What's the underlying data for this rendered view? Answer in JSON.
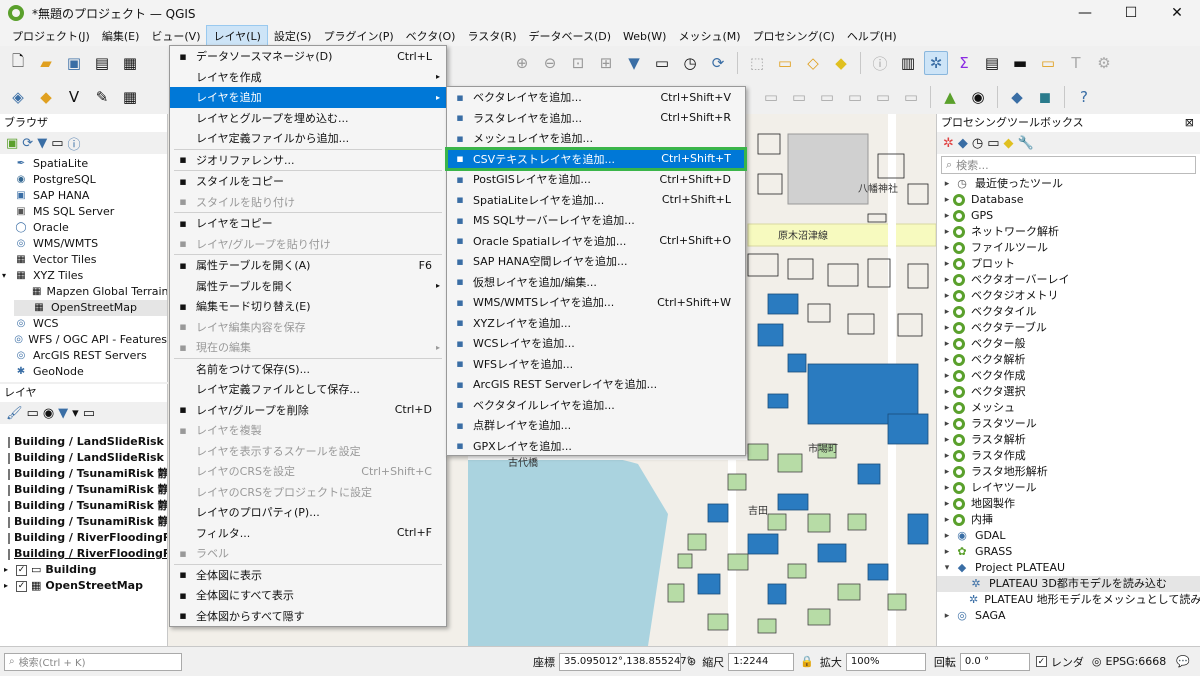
{
  "window": {
    "title": "*無題のプロジェクト — QGIS",
    "minimize": "—",
    "maximize": "☐",
    "close": "✕"
  },
  "menubar": [
    "プロジェクト(J)",
    "編集(E)",
    "ビュー(V)",
    "レイヤ(L)",
    "設定(S)",
    "プラグイン(P)",
    "ベクタ(O)",
    "ラスタ(R)",
    "データベース(D)",
    "Web(W)",
    "メッシュ(M)",
    "プロセシング(C)",
    "ヘルプ(H)"
  ],
  "browser": {
    "title": "ブラウザ",
    "items": [
      {
        "label": "SpatiaLite",
        "icon": "feather-icon"
      },
      {
        "label": "PostgreSQL",
        "icon": "elephant-icon"
      },
      {
        "label": "SAP HANA",
        "icon": "database-icon"
      },
      {
        "label": "MS SQL Server",
        "icon": "database-icon"
      },
      {
        "label": "Oracle",
        "icon": "database-icon"
      },
      {
        "label": "WMS/WMTS",
        "icon": "globe-icon"
      },
      {
        "label": "Vector Tiles",
        "icon": "tiles-icon"
      },
      {
        "label": "XYZ Tiles",
        "icon": "tiles-icon"
      },
      {
        "label": "Mapzen Global Terrain",
        "icon": "tiles-icon"
      },
      {
        "label": "OpenStreetMap",
        "icon": "tiles-icon"
      },
      {
        "label": "WCS",
        "icon": "globe-icon"
      },
      {
        "label": "WFS / OGC API - Features",
        "icon": "globe-icon"
      },
      {
        "label": "ArcGIS REST Servers",
        "icon": "globe-icon"
      },
      {
        "label": "GeoNode",
        "icon": "node-icon"
      }
    ]
  },
  "layers": {
    "title": "レイヤ",
    "items": [
      "Building / LandSlideRisk 急",
      "Building / LandSlideRisk 土",
      "Building / TsunamiRisk 静岡",
      "Building / TsunamiRisk 静岡",
      "Building / TsunamiRisk 静岡",
      "Building / TsunamiRisk 静岡",
      "Building / RiverFloodingRis",
      "Building / RiverFloodingRis"
    ],
    "group": "Building",
    "base": "OpenStreetMap"
  },
  "layer_menu": {
    "items": [
      {
        "label": "データソースマネージャ(D)",
        "shortcut": "Ctrl+L",
        "state": "normal",
        "icon": "datasource-icon"
      },
      {
        "label": "レイヤを作成",
        "shortcut": "",
        "state": "normal",
        "sub": true,
        "icon": ""
      },
      {
        "label": "レイヤを追加",
        "shortcut": "",
        "state": "highlight",
        "sub": true,
        "icon": ""
      },
      {
        "label": "レイヤとグループを埋め込む...",
        "shortcut": "",
        "state": "normal",
        "icon": ""
      },
      {
        "label": "レイヤ定義ファイルから追加...",
        "shortcut": "",
        "state": "normal",
        "icon": ""
      },
      {
        "label": "ジオリファレンサ...",
        "shortcut": "",
        "state": "normal",
        "icon": "georef-icon",
        "sepBefore": true
      },
      {
        "label": "スタイルをコピー",
        "shortcut": "",
        "state": "normal",
        "icon": "copy-style-icon",
        "sepBefore": true
      },
      {
        "label": "スタイルを貼り付け",
        "shortcut": "",
        "state": "disabled",
        "icon": "paste-style-icon"
      },
      {
        "label": "レイヤをコピー",
        "shortcut": "",
        "state": "normal",
        "icon": "copy-layer-icon",
        "sepBefore": true
      },
      {
        "label": "レイヤ/グループを貼り付け",
        "shortcut": "",
        "state": "disabled",
        "icon": "paste-layer-icon"
      },
      {
        "label": "属性テーブルを開く(A)",
        "shortcut": "F6",
        "state": "normal",
        "icon": "table-icon",
        "sepBefore": true
      },
      {
        "label": "属性テーブルを開く",
        "shortcut": "",
        "state": "normal",
        "sub": true,
        "icon": ""
      },
      {
        "label": "編集モード切り替え(E)",
        "shortcut": "",
        "state": "normal",
        "icon": "pencil-icon"
      },
      {
        "label": "レイヤ編集内容を保存",
        "shortcut": "",
        "state": "disabled",
        "icon": "save-edits-icon"
      },
      {
        "label": "現在の編集",
        "shortcut": "",
        "state": "disabled",
        "sub": true,
        "icon": "edit-icon"
      },
      {
        "label": "名前をつけて保存(S)...",
        "shortcut": "",
        "state": "normal",
        "icon": "",
        "sepBefore": true
      },
      {
        "label": "レイヤ定義ファイルとして保存...",
        "shortcut": "",
        "state": "normal",
        "icon": ""
      },
      {
        "label": "レイヤ/グループを削除",
        "shortcut": "Ctrl+D",
        "state": "normal",
        "icon": "remove-icon"
      },
      {
        "label": "レイヤを複製",
        "shortcut": "",
        "state": "disabled",
        "icon": "duplicate-icon"
      },
      {
        "label": "レイヤを表示するスケールを設定",
        "shortcut": "",
        "state": "disabled",
        "icon": ""
      },
      {
        "label": "レイヤのCRSを設定",
        "shortcut": "Ctrl+Shift+C",
        "state": "disabled",
        "icon": ""
      },
      {
        "label": "レイヤのCRSをプロジェクトに設定",
        "shortcut": "",
        "state": "disabled",
        "icon": ""
      },
      {
        "label": "レイヤのプロパティ(P)...",
        "shortcut": "",
        "state": "normal",
        "icon": ""
      },
      {
        "label": "フィルタ...",
        "shortcut": "Ctrl+F",
        "state": "normal",
        "icon": ""
      },
      {
        "label": "ラベル",
        "shortcut": "",
        "state": "disabled",
        "icon": "label-icon"
      },
      {
        "label": "全体図に表示",
        "shortcut": "",
        "state": "normal",
        "icon": "overview-icon",
        "sepBefore": true
      },
      {
        "label": "全体図にすべて表示",
        "shortcut": "",
        "state": "normal",
        "icon": "overview-icon"
      },
      {
        "label": "全体図からすべて隠す",
        "shortcut": "",
        "state": "normal",
        "icon": "overview-icon"
      }
    ]
  },
  "add_layer_menu": {
    "items": [
      {
        "label": "ベクタレイヤを追加...",
        "shortcut": "Ctrl+Shift+V",
        "icon": "vector-icon"
      },
      {
        "label": "ラスタレイヤを追加...",
        "shortcut": "Ctrl+Shift+R",
        "icon": "raster-icon"
      },
      {
        "label": "メッシュレイヤを追加...",
        "shortcut": "",
        "icon": "mesh-icon"
      },
      {
        "label": "CSVテキストレイヤを追加...",
        "shortcut": "Ctrl+Shift+T",
        "icon": "csv-icon",
        "highlight": true
      },
      {
        "label": "PostGISレイヤを追加...",
        "shortcut": "Ctrl+Shift+D",
        "icon": "postgis-icon"
      },
      {
        "label": "SpatiaLiteレイヤを追加...",
        "shortcut": "Ctrl+Shift+L",
        "icon": "spatialite-icon"
      },
      {
        "label": "MS SQLサーバーレイヤを追加...",
        "shortcut": "",
        "icon": "mssql-icon"
      },
      {
        "label": "Oracle Spatialレイヤを追加...",
        "shortcut": "Ctrl+Shift+O",
        "icon": "oracle-icon"
      },
      {
        "label": "SAP HANA空間レイヤを追加...",
        "shortcut": "",
        "icon": "hana-icon"
      },
      {
        "label": "仮想レイヤを追加/編集...",
        "shortcut": "",
        "icon": "virtual-icon"
      },
      {
        "label": "WMS/WMTSレイヤを追加...",
        "shortcut": "Ctrl+Shift+W",
        "icon": "wms-icon"
      },
      {
        "label": "XYZレイヤを追加...",
        "shortcut": "",
        "icon": "xyz-icon"
      },
      {
        "label": "WCSレイヤを追加...",
        "shortcut": "",
        "icon": "wcs-icon"
      },
      {
        "label": "WFSレイヤを追加...",
        "shortcut": "",
        "icon": "wfs-icon"
      },
      {
        "label": "ArcGIS REST Serverレイヤを追加...",
        "shortcut": "",
        "icon": "arcgis-icon"
      },
      {
        "label": "ベクタタイルレイヤを追加...",
        "shortcut": "",
        "icon": "vectortile-icon"
      },
      {
        "label": "点群レイヤを追加...",
        "shortcut": "",
        "icon": "pointcloud-icon"
      },
      {
        "label": "GPXレイヤを追加...",
        "shortcut": "",
        "icon": "gpx-icon"
      }
    ]
  },
  "toolbox": {
    "title": "プロセシングツールボックス",
    "search_placeholder": "検索...",
    "items": [
      {
        "label": "最近使ったツール",
        "icon": "clock"
      },
      {
        "label": "Database",
        "icon": "q"
      },
      {
        "label": "GPS",
        "icon": "q"
      },
      {
        "label": "ネットワーク解析",
        "icon": "q"
      },
      {
        "label": "ファイルツール",
        "icon": "q"
      },
      {
        "label": "プロット",
        "icon": "q"
      },
      {
        "label": "ベクタオーバーレイ",
        "icon": "q"
      },
      {
        "label": "ベクタジオメトリ",
        "icon": "q"
      },
      {
        "label": "ベクタタイル",
        "icon": "q"
      },
      {
        "label": "ベクタテーブル",
        "icon": "q"
      },
      {
        "label": "ベクター般",
        "icon": "q"
      },
      {
        "label": "ベクタ解析",
        "icon": "q"
      },
      {
        "label": "ベクタ作成",
        "icon": "q"
      },
      {
        "label": "ベクタ選択",
        "icon": "q"
      },
      {
        "label": "メッシュ",
        "icon": "q"
      },
      {
        "label": "ラスタツール",
        "icon": "q"
      },
      {
        "label": "ラスタ解析",
        "icon": "q"
      },
      {
        "label": "ラスタ作成",
        "icon": "q"
      },
      {
        "label": "ラスタ地形解析",
        "icon": "q"
      },
      {
        "label": "レイヤツール",
        "icon": "q"
      },
      {
        "label": "地図製作",
        "icon": "q"
      },
      {
        "label": "内挿",
        "icon": "q"
      },
      {
        "label": "GDAL",
        "icon": "gdal"
      },
      {
        "label": "GRASS",
        "icon": "grass"
      },
      {
        "label": "Project PLATEAU",
        "icon": "plateau",
        "expanded": true
      },
      {
        "label": "PLATEAU 3D都市モデルを読み込む",
        "icon": "gear",
        "child": true,
        "selected": true
      },
      {
        "label": "PLATEAU 地形モデルをメッシュとして読み込む",
        "icon": "gear",
        "child": true
      },
      {
        "label": "SAGA",
        "icon": "saga"
      }
    ]
  },
  "map_labels": [
    "八幡神社",
    "原木沼津線",
    "古代橋",
    "吉田",
    "市場町"
  ],
  "statusbar": {
    "search_placeholder": "検索(Ctrl + K)",
    "coord_label": "座標",
    "coord_value": "35.095012°,138.855247°",
    "scale_label": "縮尺",
    "scale_value": "1:2244",
    "magnifier_label": "拡大",
    "magnifier_value": "100%",
    "rotation_label": "回転",
    "rotation_value": "0.0 °",
    "render_label": "レンダ",
    "crs": "EPSG:6668"
  },
  "colors": {
    "highlight": "#0078d7",
    "green_box": "#3ab54a",
    "building_blue": "#2a7bc0",
    "building_green": "#b7dca6",
    "water": "#aad3df"
  }
}
